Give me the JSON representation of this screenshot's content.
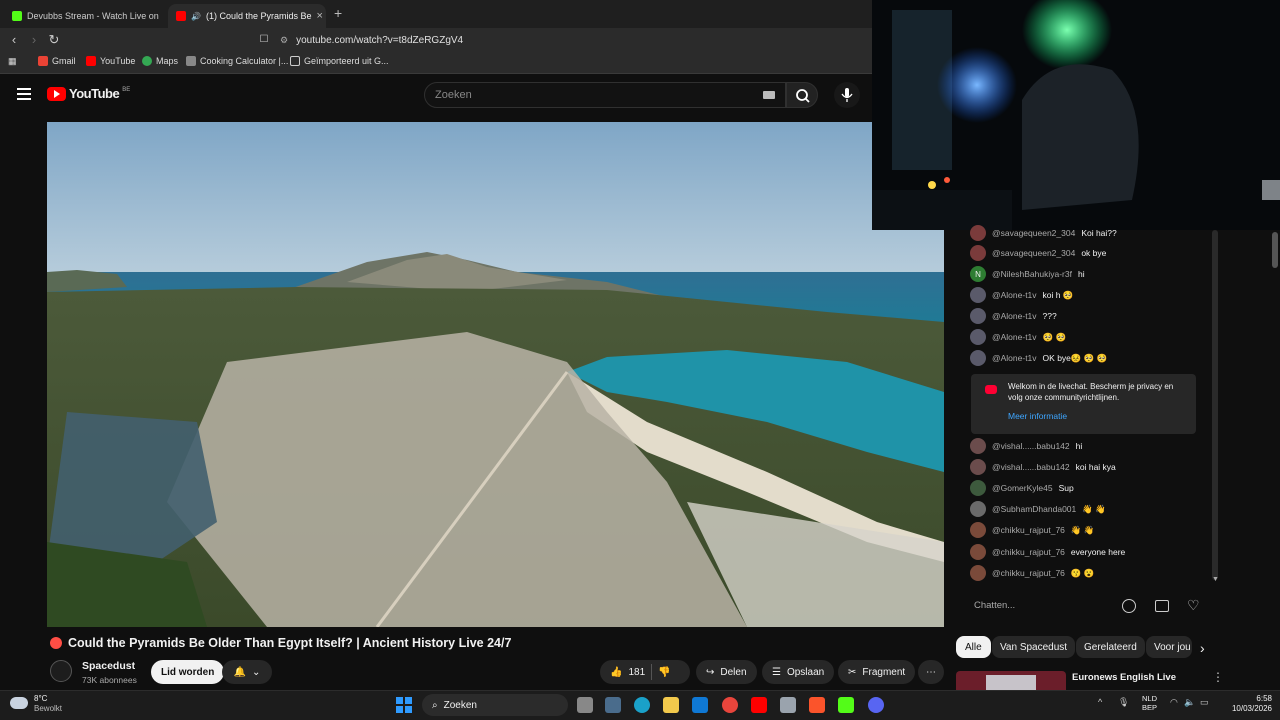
{
  "browser": {
    "tabs": [
      {
        "label": "Devubbs Stream - Watch Live on",
        "active": false,
        "favicon_color": "#53fc18"
      },
      {
        "label": "(1) Could the Pyramids Be",
        "active": true,
        "favicon_color": "#ff0000"
      }
    ],
    "url": "youtube.com/watch?v=t8dZeRGZgV4",
    "bookmarks": [
      {
        "label": "Gmail",
        "icon_color": "#ea4335"
      },
      {
        "label": "YouTube",
        "icon_color": "#ff0000"
      },
      {
        "label": "Maps",
        "icon_color": "#34a853"
      },
      {
        "label": "Cooking Calculator |...",
        "icon_color": "#888888"
      },
      {
        "label": "Geïmporteerd uit G...",
        "icon_color": "#cccccc"
      }
    ]
  },
  "youtube": {
    "logo_text": "YouTube",
    "country": "BE",
    "search_placeholder": "Zoeken"
  },
  "video": {
    "title": "Could the Pyramids Be Older Than Egypt Itself? | Ancient History Live 24/7",
    "channel": "Spacedust",
    "subscribers": "73K abonnees",
    "join_label": "Lid worden",
    "likes": "181",
    "share_label": "Delen",
    "save_label": "Opslaan",
    "clip_label": "Fragment"
  },
  "chat": {
    "messages": [
      {
        "author": "@savagequeen2_304",
        "text": "Koi hai??",
        "avatar": "#7a3b3b"
      },
      {
        "author": "@savagequeen2_304",
        "text": "ok bye",
        "avatar": "#7a3b3b"
      },
      {
        "author": "@NileshBahukiya-r3f",
        "text": "hi",
        "avatar": "#2e7d32",
        "initial": "N"
      },
      {
        "author": "@Alone-t1v",
        "text": "koi h 🥺",
        "avatar": "#5a5a6a"
      },
      {
        "author": "@Alone-t1v",
        "text": "???",
        "avatar": "#5a5a6a"
      },
      {
        "author": "@Alone-t1v",
        "text": "🥺 🥺",
        "avatar": "#5a5a6a"
      },
      {
        "author": "@Alone-t1v",
        "text": "OK bye😣 🥺 🥺",
        "avatar": "#5a5a6a"
      },
      {
        "author": "@vishal......babu142",
        "text": "hi",
        "avatar": "#6b4c4c"
      },
      {
        "author": "@vishal......babu142",
        "text": "koi hai kya",
        "avatar": "#6b4c4c"
      },
      {
        "author": "@GomerKyle45",
        "text": "Sup",
        "avatar": "#3d5a3d"
      },
      {
        "author": "@SubhamDhanda001",
        "text": "👋 👋",
        "avatar": "#6a6a6a"
      },
      {
        "author": "@chikku_rajput_76",
        "text": "👋 👋",
        "avatar": "#7a4a3a"
      },
      {
        "author": "@chikku_rajput_76",
        "text": "everyone here",
        "avatar": "#7a4a3a"
      },
      {
        "author": "@chikku_rajput_76",
        "text": "😗 😮",
        "avatar": "#7a4a3a"
      }
    ],
    "welcome_text": "Welkom in de livechat. Bescherm je privacy en volg onze communityrichtlijnen.",
    "welcome_link": "Meer informatie",
    "input_placeholder": "Chatten..."
  },
  "chips": [
    "Alle",
    "Van Spacedust",
    "Gerelateerd",
    "Voor jou"
  ],
  "recommendation": {
    "title": "Euronews English Live"
  },
  "taskbar": {
    "weather_temp": "8°C",
    "weather_desc": "Bewolkt",
    "search_label": "Zoeken",
    "lang_1": "NLD",
    "lang_2": "BEP",
    "time": "6:58",
    "date": "10/03/2026"
  }
}
